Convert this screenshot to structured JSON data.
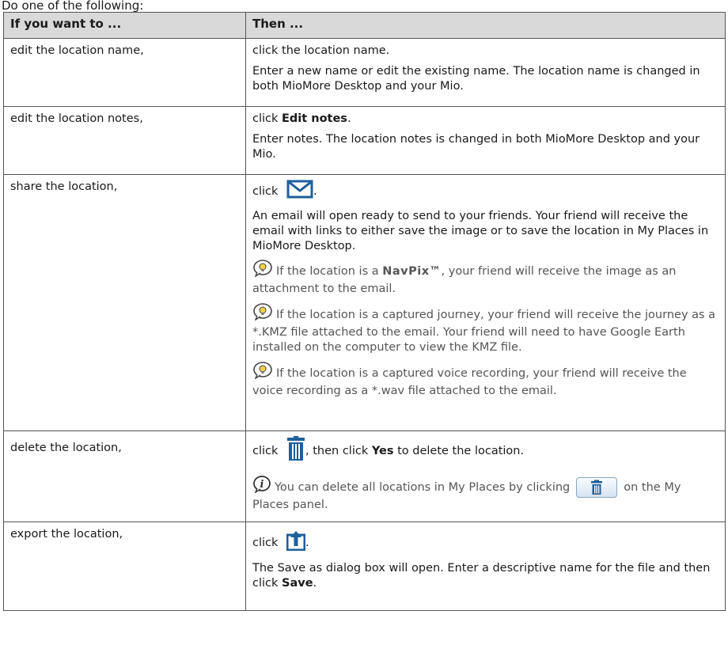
{
  "intro": "Do one of the following:",
  "table": {
    "headers": [
      "If you want to ...",
      "Then ..."
    ],
    "rows": [
      {
        "action": "edit the location name,",
        "line1": "click the location name.",
        "line2": "Enter a new name or edit the existing name. The location name is changed in both MioMore Desktop and your Mio."
      },
      {
        "action": "edit the location notes,",
        "line1_pre": "click ",
        "line1_bold": "Edit notes",
        "line1_post": ".",
        "line2": "Enter notes. The location notes is changed in both MioMore Desktop and your Mio."
      },
      {
        "action": "share the location,",
        "line1_pre": "click",
        "line1_post": ".",
        "line2": "An email will open ready to send to your friends. Your friend will receive the email with links to either save the image or to save the location in My Places in MioMore Desktop.",
        "tip1_pre": "If the location is a ",
        "tip1_brand": "NavPix™",
        "tip1_post": ", your friend will receive the image as an attachment to the email.",
        "tip2": "If the location is a captured journey, your friend will receive the journey as a *.KMZ file attached to the email. Your friend will need to have Google Earth installed on the computer to view the KMZ file.",
        "tip3": "If the location is a captured voice recording, your friend will receive the voice recording as a *.wav file attached to the email."
      },
      {
        "action": "delete the location,",
        "line1_pre": "click",
        "line1_mid": ", then click ",
        "line1_bold": "Yes",
        "line1_post": " to delete the location.",
        "info_pre": "You can delete all locations in My Places by clicking",
        "info_post": "on the My Places panel."
      },
      {
        "action": "export the location,",
        "line1_pre": "click",
        "line1_post": ".",
        "line2_pre": "The Save as dialog box will open. Enter a descriptive name for the file and then click ",
        "line2_bold": "Save",
        "line2_post": "."
      }
    ]
  },
  "icons": {
    "email": "envelope-icon",
    "tip": "lightbulb-tip-icon",
    "info": "info-icon",
    "trash": "trash-icon",
    "export": "export-icon"
  },
  "colors": {
    "header_bg": "#d9d9d9",
    "note_text": "#555555",
    "icon_blue": "#1f5f9c"
  }
}
